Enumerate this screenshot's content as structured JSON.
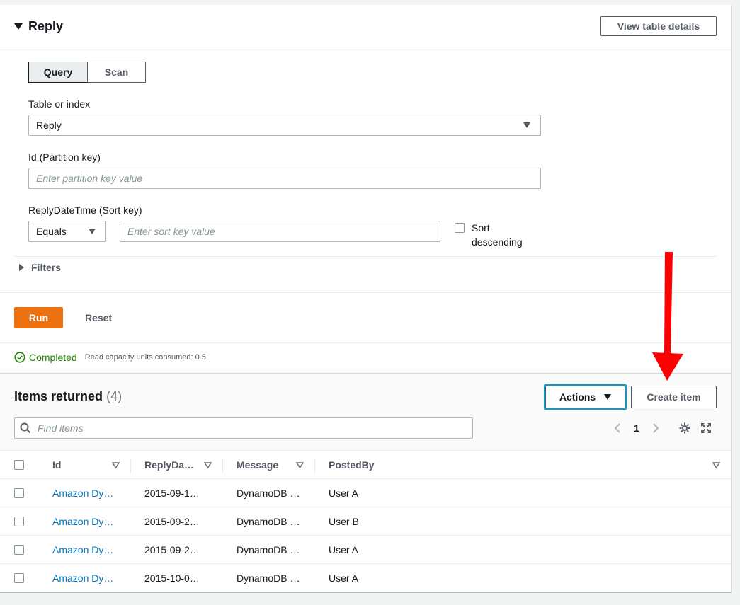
{
  "header": {
    "title": "Reply",
    "view_details_label": "View table details"
  },
  "tabs": [
    {
      "label": "Query",
      "selected": true
    },
    {
      "label": "Scan",
      "selected": false
    }
  ],
  "table_or_index": {
    "label": "Table or index",
    "value": "Reply"
  },
  "partition_key": {
    "label": "Id (Partition key)",
    "placeholder": "Enter partition key value"
  },
  "sort_key": {
    "label": "ReplyDateTime (Sort key)",
    "operator": "Equals",
    "placeholder": "Enter sort key value",
    "sort_desc_line1": "Sort",
    "sort_desc_line2": "descending"
  },
  "filters": {
    "label": "Filters"
  },
  "actions": {
    "run_label": "Run",
    "reset_label": "Reset"
  },
  "status": {
    "text": "Completed",
    "detail": "Read capacity units consumed: 0.5",
    "color": "#1d8102"
  },
  "items": {
    "title": "Items returned",
    "count": "(4)",
    "actions_label": "Actions",
    "create_label": "Create item",
    "search_placeholder": "Find items",
    "page": "1"
  },
  "table": {
    "columns": [
      "Id",
      "ReplyDa…",
      "Message",
      "PostedBy"
    ],
    "rows": [
      [
        "Amazon Dy…",
        "2015-09-1…",
        "DynamoDB …",
        "User A"
      ],
      [
        "Amazon Dy…",
        "2015-09-2…",
        "DynamoDB …",
        "User B"
      ],
      [
        "Amazon Dy…",
        "2015-09-2…",
        "DynamoDB …",
        "User A"
      ],
      [
        "Amazon Dy…",
        "2015-10-0…",
        "DynamoDB …",
        "User A"
      ]
    ]
  },
  "colors": {
    "accent": "#ec7211",
    "link": "#0073bb",
    "arrow": "#ff0000"
  }
}
